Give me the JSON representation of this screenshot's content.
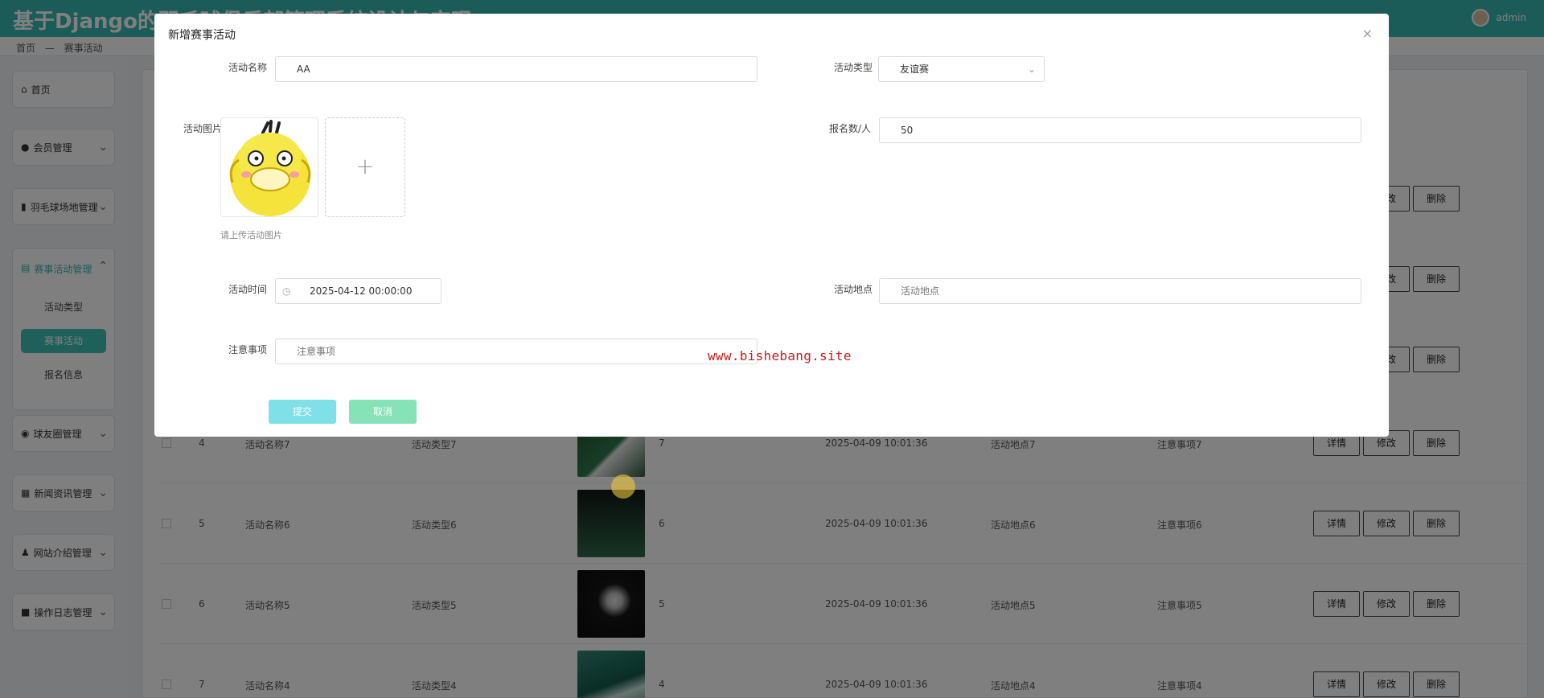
{
  "header": {
    "app_title": "基于Django的羽毛球俱乐部管理系统设计与实现",
    "user": "admin"
  },
  "breadcrumb": {
    "home": "首页",
    "sep": "—",
    "current": "赛事活动"
  },
  "sidebar": {
    "home": "首页",
    "members": "会员管理",
    "courts": "羽毛球场地管理",
    "events": "赛事活动管理",
    "events_sub": [
      "活动类型",
      "赛事活动",
      "报名信息"
    ],
    "circle": "球友圈管理",
    "news": "新闻资讯管理",
    "site": "网站介绍管理",
    "logs": "操作日志管理"
  },
  "table": {
    "actions": {
      "detail": "详情",
      "edit": "修改",
      "delete": "删除"
    },
    "rows": [
      {
        "idx": "4",
        "name": "活动名称7",
        "type": "活动类型7",
        "count": "7",
        "time": "2025-04-09 10:01:36",
        "place": "活动地点7",
        "note": "注意事项7"
      },
      {
        "idx": "5",
        "name": "活动名称6",
        "type": "活动类型6",
        "count": "6",
        "time": "2025-04-09 10:01:36",
        "place": "活动地点6",
        "note": "注意事项6"
      },
      {
        "idx": "6",
        "name": "活动名称5",
        "type": "活动类型5",
        "count": "5",
        "time": "2025-04-09 10:01:36",
        "place": "活动地点5",
        "note": "注意事项5"
      },
      {
        "idx": "7",
        "name": "活动名称4",
        "type": "活动类型4",
        "count": "4",
        "time": "2025-04-09 10:01:36",
        "place": "活动地点4",
        "note": "注意事项4"
      }
    ]
  },
  "modal": {
    "title": "新增赛事活动",
    "close": "×",
    "fields": {
      "name_label": "活动名称",
      "name_value": "AA",
      "type_label": "活动类型",
      "type_value": "友谊赛",
      "image_label": "活动图片",
      "image_hint": "请上传活动图片",
      "signup_label": "报名数/人",
      "signup_value": "50",
      "time_label": "活动时间",
      "time_value": "2025-04-12 00:00:00",
      "place_label": "活动地点",
      "place_placeholder": "活动地点",
      "note_label": "注意事项",
      "note_placeholder": "注意事项"
    },
    "submit": "提交",
    "cancel": "取消"
  },
  "watermark": "www.bishebang.site",
  "colors": {
    "accent": "#36b9b0",
    "submit": "#7fe0e8",
    "cancel": "#86e3b8",
    "watermark": "#d01818"
  }
}
